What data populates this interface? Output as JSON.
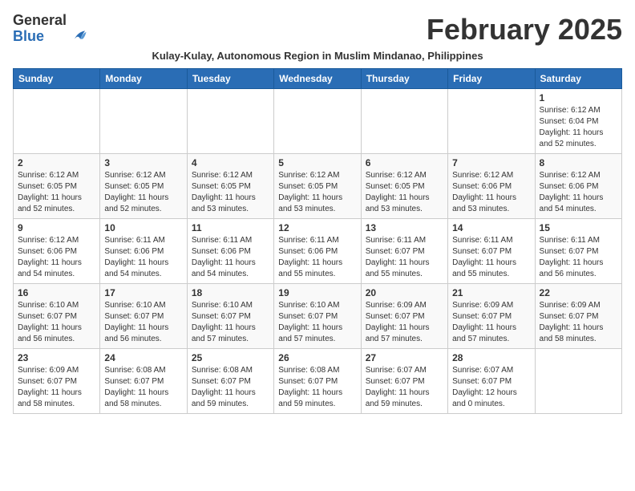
{
  "header": {
    "logo_general": "General",
    "logo_blue": "Blue",
    "month_title": "February 2025",
    "subtitle": "Kulay-Kulay, Autonomous Region in Muslim Mindanao, Philippines"
  },
  "weekdays": [
    "Sunday",
    "Monday",
    "Tuesday",
    "Wednesday",
    "Thursday",
    "Friday",
    "Saturday"
  ],
  "weeks": [
    [
      {
        "day": "",
        "info": ""
      },
      {
        "day": "",
        "info": ""
      },
      {
        "day": "",
        "info": ""
      },
      {
        "day": "",
        "info": ""
      },
      {
        "day": "",
        "info": ""
      },
      {
        "day": "",
        "info": ""
      },
      {
        "day": "1",
        "info": "Sunrise: 6:12 AM\nSunset: 6:04 PM\nDaylight: 11 hours\nand 52 minutes."
      }
    ],
    [
      {
        "day": "2",
        "info": "Sunrise: 6:12 AM\nSunset: 6:05 PM\nDaylight: 11 hours\nand 52 minutes."
      },
      {
        "day": "3",
        "info": "Sunrise: 6:12 AM\nSunset: 6:05 PM\nDaylight: 11 hours\nand 52 minutes."
      },
      {
        "day": "4",
        "info": "Sunrise: 6:12 AM\nSunset: 6:05 PM\nDaylight: 11 hours\nand 53 minutes."
      },
      {
        "day": "5",
        "info": "Sunrise: 6:12 AM\nSunset: 6:05 PM\nDaylight: 11 hours\nand 53 minutes."
      },
      {
        "day": "6",
        "info": "Sunrise: 6:12 AM\nSunset: 6:05 PM\nDaylight: 11 hours\nand 53 minutes."
      },
      {
        "day": "7",
        "info": "Sunrise: 6:12 AM\nSunset: 6:06 PM\nDaylight: 11 hours\nand 53 minutes."
      },
      {
        "day": "8",
        "info": "Sunrise: 6:12 AM\nSunset: 6:06 PM\nDaylight: 11 hours\nand 54 minutes."
      }
    ],
    [
      {
        "day": "9",
        "info": "Sunrise: 6:12 AM\nSunset: 6:06 PM\nDaylight: 11 hours\nand 54 minutes."
      },
      {
        "day": "10",
        "info": "Sunrise: 6:11 AM\nSunset: 6:06 PM\nDaylight: 11 hours\nand 54 minutes."
      },
      {
        "day": "11",
        "info": "Sunrise: 6:11 AM\nSunset: 6:06 PM\nDaylight: 11 hours\nand 54 minutes."
      },
      {
        "day": "12",
        "info": "Sunrise: 6:11 AM\nSunset: 6:06 PM\nDaylight: 11 hours\nand 55 minutes."
      },
      {
        "day": "13",
        "info": "Sunrise: 6:11 AM\nSunset: 6:07 PM\nDaylight: 11 hours\nand 55 minutes."
      },
      {
        "day": "14",
        "info": "Sunrise: 6:11 AM\nSunset: 6:07 PM\nDaylight: 11 hours\nand 55 minutes."
      },
      {
        "day": "15",
        "info": "Sunrise: 6:11 AM\nSunset: 6:07 PM\nDaylight: 11 hours\nand 56 minutes."
      }
    ],
    [
      {
        "day": "16",
        "info": "Sunrise: 6:10 AM\nSunset: 6:07 PM\nDaylight: 11 hours\nand 56 minutes."
      },
      {
        "day": "17",
        "info": "Sunrise: 6:10 AM\nSunset: 6:07 PM\nDaylight: 11 hours\nand 56 minutes."
      },
      {
        "day": "18",
        "info": "Sunrise: 6:10 AM\nSunset: 6:07 PM\nDaylight: 11 hours\nand 57 minutes."
      },
      {
        "day": "19",
        "info": "Sunrise: 6:10 AM\nSunset: 6:07 PM\nDaylight: 11 hours\nand 57 minutes."
      },
      {
        "day": "20",
        "info": "Sunrise: 6:09 AM\nSunset: 6:07 PM\nDaylight: 11 hours\nand 57 minutes."
      },
      {
        "day": "21",
        "info": "Sunrise: 6:09 AM\nSunset: 6:07 PM\nDaylight: 11 hours\nand 57 minutes."
      },
      {
        "day": "22",
        "info": "Sunrise: 6:09 AM\nSunset: 6:07 PM\nDaylight: 11 hours\nand 58 minutes."
      }
    ],
    [
      {
        "day": "23",
        "info": "Sunrise: 6:09 AM\nSunset: 6:07 PM\nDaylight: 11 hours\nand 58 minutes."
      },
      {
        "day": "24",
        "info": "Sunrise: 6:08 AM\nSunset: 6:07 PM\nDaylight: 11 hours\nand 58 minutes."
      },
      {
        "day": "25",
        "info": "Sunrise: 6:08 AM\nSunset: 6:07 PM\nDaylight: 11 hours\nand 59 minutes."
      },
      {
        "day": "26",
        "info": "Sunrise: 6:08 AM\nSunset: 6:07 PM\nDaylight: 11 hours\nand 59 minutes."
      },
      {
        "day": "27",
        "info": "Sunrise: 6:07 AM\nSunset: 6:07 PM\nDaylight: 11 hours\nand 59 minutes."
      },
      {
        "day": "28",
        "info": "Sunrise: 6:07 AM\nSunset: 6:07 PM\nDaylight: 12 hours\nand 0 minutes."
      },
      {
        "day": "",
        "info": ""
      }
    ]
  ]
}
